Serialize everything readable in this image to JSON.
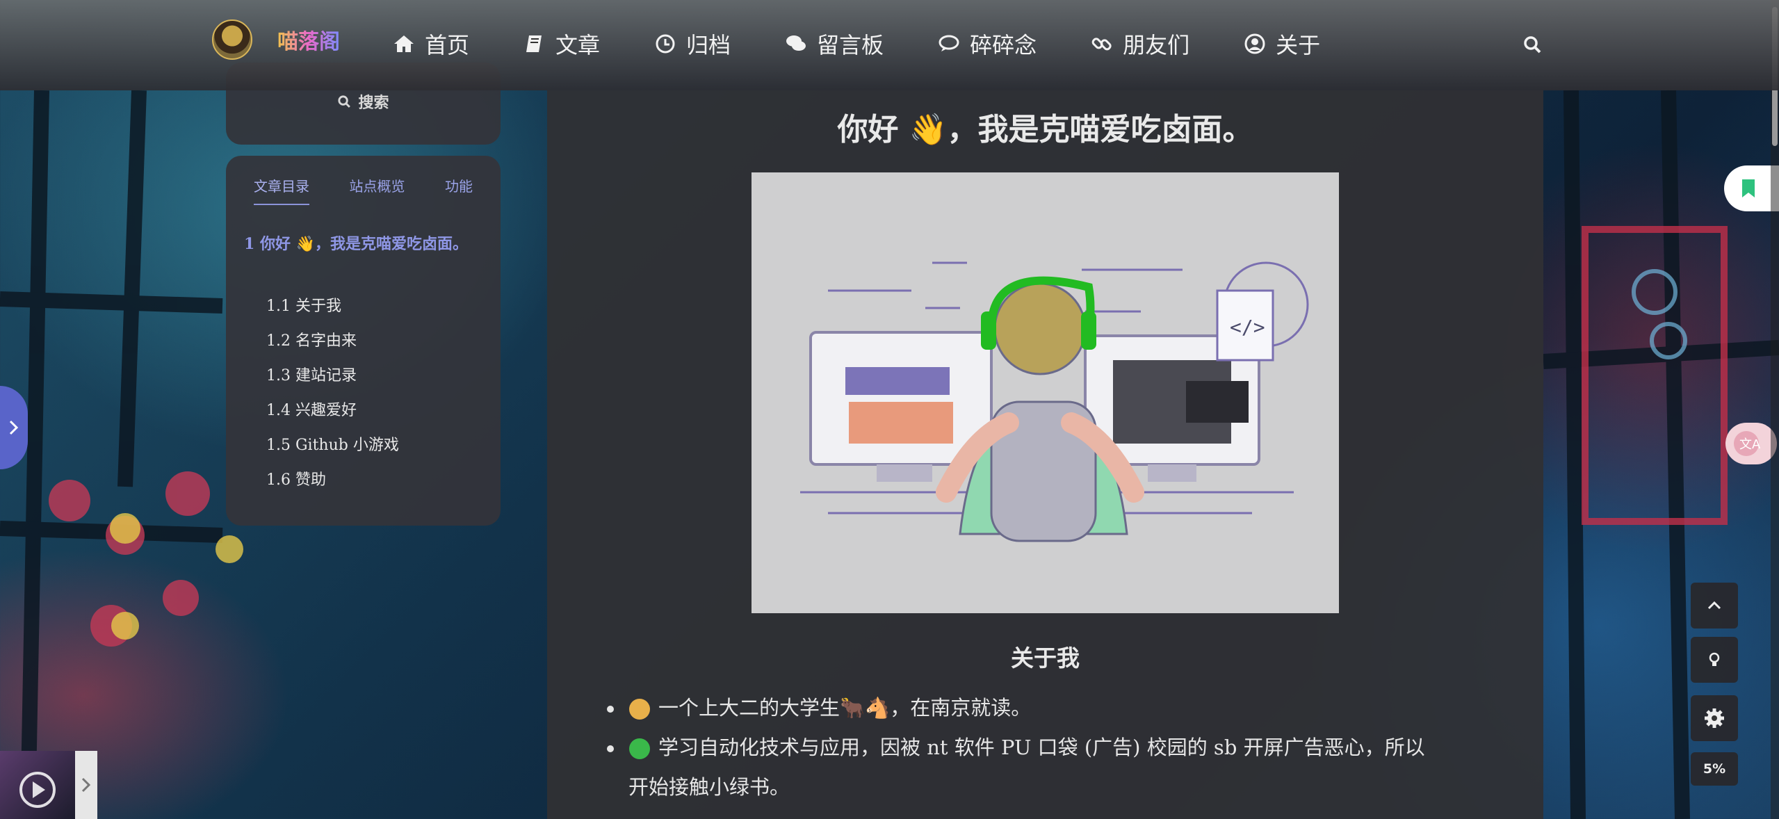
{
  "brand": {
    "site_name": "喵落阁"
  },
  "nav": {
    "items": [
      {
        "label": "首页",
        "icon": "home-icon"
      },
      {
        "label": "文章",
        "icon": "book-icon"
      },
      {
        "label": "归档",
        "icon": "clock-icon"
      },
      {
        "label": "留言板",
        "icon": "comments-icon"
      },
      {
        "label": "碎碎念",
        "icon": "comment-icon"
      },
      {
        "label": "朋友们",
        "icon": "link-icon"
      },
      {
        "label": "关于",
        "icon": "user-circle-icon"
      }
    ]
  },
  "sidebar": {
    "search_label": "搜索",
    "tabs": [
      "文章目录",
      "站点概览",
      "功能"
    ],
    "toc_main": "1 你好 👋，我是克喵爱吃卤面。",
    "toc_items": [
      "1.1 关于我",
      "1.2 名字由来",
      "1.3 建站记录",
      "1.4 兴趣爱好",
      "1.5 Github 小游戏",
      "1.6 赞助"
    ]
  },
  "article": {
    "title": "你好 👋，我是克喵爱吃卤面。",
    "section_title": "关于我",
    "list": [
      {
        "text": "一个上大二的大学生🐂🐴，在南京就读。"
      },
      {
        "text": "学习自动化技术与应用，因被 nt 软件 PU 口袋 (广告) 校园的 sb 开屏广告恶心，所以"
      },
      {
        "text": "开始接触小绿书。"
      }
    ]
  },
  "floating": {
    "progress_label": "5%"
  },
  "colors": {
    "accent": "#8f97e6",
    "drawer": "#5964c9",
    "bookmark_green": "#2ec27e"
  }
}
